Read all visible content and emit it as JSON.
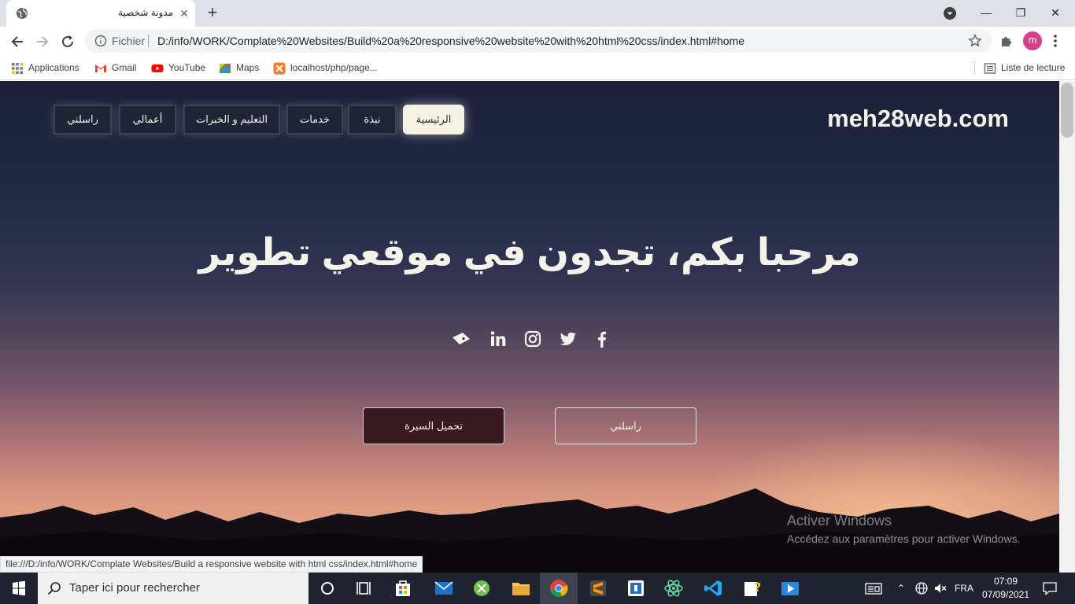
{
  "browser": {
    "tab_title": "مدونة شخصية",
    "scheme_label": "Fichier",
    "url": "D:/info/WORK/Complate%20Websites/Build%20a%20responsive%20website%20with%20html%20css/index.html#home",
    "profile_initial": "m",
    "bookmarks": [
      {
        "label": "Applications",
        "icon": "apps-grid-icon"
      },
      {
        "label": "Gmail",
        "icon": "gmail-icon"
      },
      {
        "label": "YouTube",
        "icon": "youtube-icon"
      },
      {
        "label": "Maps",
        "icon": "maps-icon"
      },
      {
        "label": "localhost/php/page...",
        "icon": "xampp-icon"
      }
    ],
    "reading_list": "Liste de lecture",
    "status_url": "file:///D:/info/WORK/Complate Websites/Build a responsive website with html css/index.html#home"
  },
  "site": {
    "logo": "meh28web.com",
    "nav": [
      {
        "label": "الرئيسية",
        "active": true
      },
      {
        "label": "نبذة",
        "active": false
      },
      {
        "label": "خدمات",
        "active": false
      },
      {
        "label": "التعليم و الخبرات",
        "active": false
      },
      {
        "label": "أعمالي",
        "active": false
      },
      {
        "label": "راسلني",
        "active": false
      }
    ],
    "hero_title": "مرحبا بكم، تجدون في موقعي تطوير",
    "social_icons": [
      "facebook-icon",
      "twitter-icon",
      "instagram-icon",
      "linkedin-icon",
      "tag-icon"
    ],
    "cv_button": "تحميل السيرة",
    "contact_button": "راسلني"
  },
  "watermark": {
    "title": "Activer Windows",
    "subtitle": "Accédez aux paramètres pour activer Windows."
  },
  "taskbar": {
    "search_placeholder": "Taper ici pour rechercher",
    "language": "FRA",
    "time": "07:09",
    "date": "07/09/2021"
  }
}
